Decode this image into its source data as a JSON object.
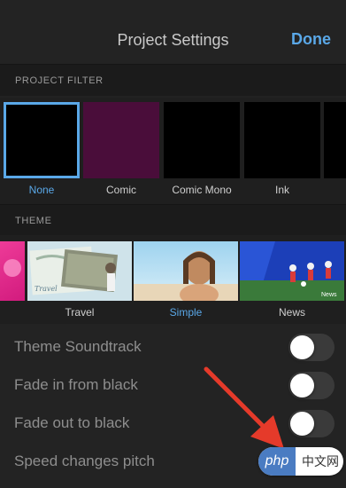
{
  "header": {
    "title": "Project Settings",
    "done_label": "Done"
  },
  "project_filter": {
    "section_label": "PROJECT FILTER",
    "items": [
      {
        "label": "None",
        "selected": true,
        "color": "#000000"
      },
      {
        "label": "Comic",
        "selected": false,
        "color": "#4a0d3a"
      },
      {
        "label": "Comic Mono",
        "selected": false,
        "color": "#000000"
      },
      {
        "label": "Ink",
        "selected": false,
        "color": "#000000"
      }
    ]
  },
  "theme": {
    "section_label": "THEME",
    "items": [
      {
        "label": "",
        "selected": false
      },
      {
        "label": "Travel",
        "selected": false
      },
      {
        "label": "Simple",
        "selected": true
      },
      {
        "label": "News",
        "selected": false
      }
    ],
    "news_badge": "News"
  },
  "settings": [
    {
      "label": "Theme Soundtrack",
      "on": false
    },
    {
      "label": "Fade in from black",
      "on": false
    },
    {
      "label": "Fade out to black",
      "on": false
    },
    {
      "label": "Speed changes pitch",
      "on": true
    }
  ],
  "colors": {
    "accent": "#5aa8e8",
    "arrow": "#e53a2a"
  },
  "watermark": {
    "left": "php",
    "right": "中文网"
  }
}
